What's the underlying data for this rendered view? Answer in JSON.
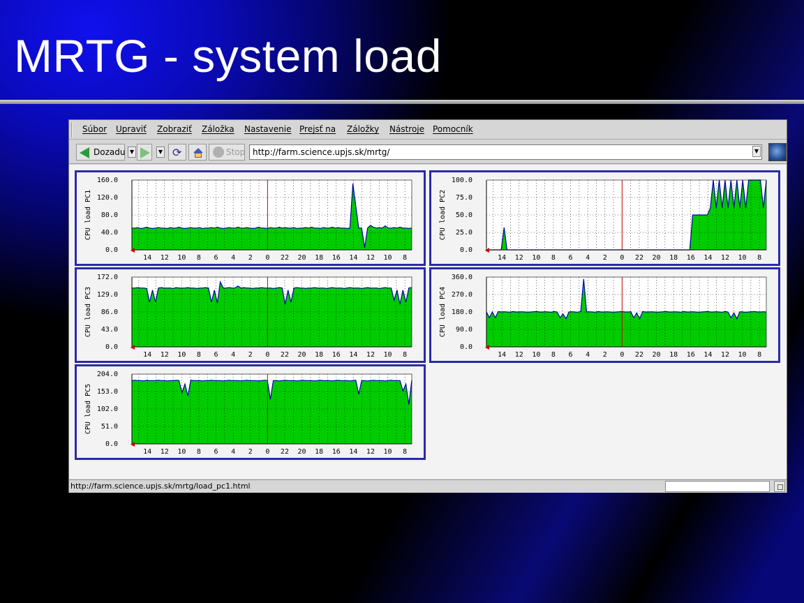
{
  "slide": {
    "title": "MRTG - system load"
  },
  "browser": {
    "menus": [
      "Súbor",
      "Upraviť",
      "Zobraziť",
      "Záložka",
      "Nastavenie",
      "Prejsť na",
      "Záložky",
      "Nástroje",
      "Pomocník"
    ],
    "back_label": "Dozadu",
    "stop_label": "Stop",
    "url": "http://farm.science.upjs.sk/mrtg/",
    "status": "http://farm.science.upjs.sk/mrtg/load_pc1.html"
  },
  "colors": {
    "fill": "#00cc00",
    "line": "#0000aa",
    "marker": "#cc0000",
    "frame": "#2a2aaa"
  },
  "chart_data": [
    {
      "type": "area",
      "ylabel": "CPU load PC1",
      "y_ticks": [
        "160.0",
        "120.0",
        "80.0",
        "40.0",
        "0.0"
      ],
      "ylim": [
        0,
        160
      ],
      "x_ticks": [
        "14",
        "12",
        "10",
        "8",
        "6",
        "4",
        "2",
        "0",
        "22",
        "20",
        "18",
        "16",
        "14",
        "12",
        "10",
        "8"
      ],
      "series": [
        {
          "values": [
            50,
            50,
            51,
            49,
            50,
            52,
            50,
            49,
            50,
            51,
            50,
            50,
            49,
            51,
            50,
            50,
            52,
            50,
            49,
            50,
            51,
            50,
            50,
            51,
            49,
            50,
            50,
            51,
            50,
            52,
            50,
            49,
            50,
            51,
            50,
            50,
            52,
            50,
            50,
            51,
            50,
            49,
            50,
            52,
            50,
            50,
            49,
            51,
            50,
            50,
            52,
            50,
            51,
            50,
            50,
            51,
            49,
            50,
            50,
            51,
            50,
            52,
            50,
            50,
            49,
            51,
            50,
            50,
            52,
            50,
            51,
            50,
            50,
            49,
            50,
            152,
            100,
            50,
            50,
            5,
            50,
            56,
            52,
            50,
            51,
            50,
            55,
            50,
            50,
            51,
            50,
            52,
            50,
            50,
            49,
            50
          ]
        }
      ]
    },
    {
      "type": "area",
      "ylabel": "CPU load PC2",
      "y_ticks": [
        "100.0",
        "75.0",
        "50.0",
        "25.0",
        "0.0"
      ],
      "ylim": [
        0,
        100
      ],
      "x_ticks": [
        "14",
        "12",
        "10",
        "8",
        "6",
        "4",
        "2",
        "0",
        "22",
        "20",
        "18",
        "16",
        "14",
        "12",
        "10",
        "8"
      ],
      "series": [
        {
          "values": [
            0,
            0,
            0,
            0,
            0,
            0,
            32,
            0,
            0,
            0,
            0,
            0,
            0,
            0,
            0,
            0,
            0,
            0,
            0,
            0,
            0,
            0,
            0,
            0,
            0,
            0,
            0,
            0,
            0,
            0,
            0,
            0,
            0,
            0,
            0,
            0,
            0,
            0,
            0,
            0,
            0,
            0,
            0,
            0,
            0,
            0,
            0,
            0,
            0,
            0,
            0,
            0,
            0,
            0,
            0,
            0,
            0,
            0,
            0,
            0,
            0,
            0,
            0,
            0,
            0,
            0,
            0,
            0,
            0,
            0,
            50,
            50,
            50,
            50,
            50,
            50,
            60,
            100,
            60,
            100,
            60,
            100,
            60,
            100,
            60,
            100,
            60,
            100,
            60,
            100,
            100,
            100,
            100,
            100,
            60,
            100
          ]
        }
      ]
    },
    {
      "type": "area",
      "ylabel": "CPU load PC3",
      "y_ticks": [
        "172.0",
        "129.0",
        "86.0",
        "43.0",
        "0.0"
      ],
      "ylim": [
        0,
        172
      ],
      "x_ticks": [
        "14",
        "12",
        "10",
        "8",
        "6",
        "4",
        "2",
        "0",
        "22",
        "20",
        "18",
        "16",
        "14",
        "12",
        "10",
        "8"
      ],
      "series": [
        {
          "values": [
            145,
            145,
            146,
            145,
            145,
            144,
            110,
            140,
            110,
            145,
            146,
            145,
            145,
            145,
            144,
            146,
            145,
            145,
            145,
            146,
            145,
            145,
            144,
            145,
            145,
            146,
            145,
            110,
            140,
            108,
            160,
            145,
            145,
            146,
            145,
            145,
            150,
            145,
            146,
            145,
            145,
            144,
            145,
            145,
            146,
            145,
            145,
            145,
            144,
            145,
            146,
            145,
            105,
            140,
            110,
            145,
            146,
            145,
            145,
            144,
            145,
            145,
            146,
            145,
            145,
            145,
            144,
            145,
            146,
            145,
            145,
            145,
            144,
            145,
            146,
            145,
            145,
            145,
            144,
            145,
            146,
            145,
            145,
            145,
            144,
            145,
            146,
            145,
            145,
            115,
            140,
            105,
            140,
            110,
            145,
            146
          ]
        }
      ]
    },
    {
      "type": "area",
      "ylabel": "CPU load PC4",
      "y_ticks": [
        "360.0",
        "270.0",
        "180.0",
        "90.0",
        "0.0"
      ],
      "ylim": [
        0,
        360
      ],
      "x_ticks": [
        "14",
        "12",
        "10",
        "8",
        "6",
        "4",
        "2",
        "0",
        "22",
        "20",
        "18",
        "16",
        "14",
        "12",
        "10",
        "8"
      ],
      "series": [
        {
          "values": [
            180,
            150,
            180,
            150,
            182,
            180,
            181,
            180,
            179,
            182,
            180,
            180,
            181,
            180,
            179,
            180,
            181,
            182,
            180,
            180,
            181,
            180,
            179,
            182,
            180,
            150,
            170,
            145,
            180,
            181,
            180,
            179,
            182,
            350,
            180,
            181,
            180,
            179,
            182,
            180,
            180,
            181,
            180,
            179,
            180,
            181,
            182,
            180,
            180,
            181,
            150,
            175,
            145,
            182,
            180,
            180,
            181,
            180,
            179,
            180,
            181,
            182,
            180,
            180,
            181,
            180,
            179,
            182,
            180,
            180,
            181,
            180,
            179,
            180,
            181,
            182,
            180,
            180,
            181,
            180,
            179,
            182,
            180,
            150,
            175,
            145,
            181,
            180,
            179,
            180,
            181,
            182,
            180,
            180,
            181,
            180
          ]
        }
      ]
    },
    {
      "type": "area",
      "ylabel": "CPU load PC5",
      "y_ticks": [
        "204.0",
        "153.0",
        "102.0",
        "51.0",
        "0.0"
      ],
      "ylim": [
        0,
        204
      ],
      "x_ticks": [
        "14",
        "12",
        "10",
        "8",
        "6",
        "4",
        "2",
        "0",
        "22",
        "20",
        "18",
        "16",
        "14",
        "12",
        "10",
        "8"
      ],
      "series": [
        {
          "values": [
            185,
            186,
            185,
            185,
            184,
            186,
            185,
            185,
            185,
            186,
            185,
            185,
            184,
            185,
            185,
            186,
            185,
            150,
            175,
            140,
            186,
            185,
            185,
            185,
            184,
            185,
            185,
            186,
            185,
            185,
            185,
            184,
            185,
            186,
            185,
            185,
            185,
            184,
            185,
            186,
            185,
            185,
            185,
            184,
            185,
            186,
            185,
            130,
            185,
            185,
            184,
            185,
            186,
            185,
            185,
            185,
            184,
            185,
            186,
            185,
            185,
            185,
            184,
            185,
            186,
            185,
            185,
            185,
            184,
            185,
            186,
            185,
            185,
            185,
            184,
            185,
            186,
            145,
            185,
            185,
            184,
            185,
            186,
            185,
            185,
            185,
            184,
            185,
            186,
            185,
            185,
            185,
            155,
            175,
            115,
            186
          ]
        }
      ]
    }
  ]
}
